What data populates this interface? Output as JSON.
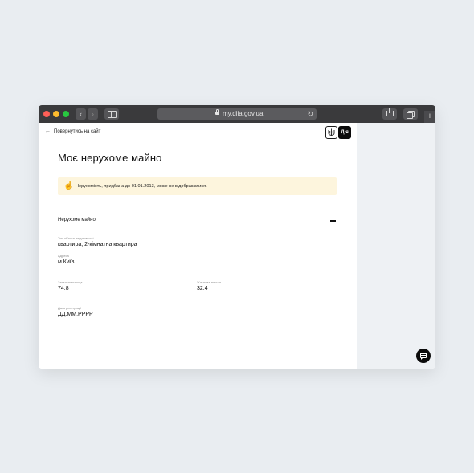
{
  "browser": {
    "url": "my.diia.gov.ua",
    "reload_icon": "↻",
    "nav_back_icon": "‹",
    "nav_forward_icon": "›",
    "new_tab_icon": "+"
  },
  "header": {
    "back_arrow": "←",
    "back_label": "Повернутись на сайт",
    "crest_icon": "trident",
    "logo_text": "Дія"
  },
  "page": {
    "title": "Моє нерухоме майно",
    "notice": {
      "icon": "☝",
      "text": "Нерухомість, придбана до 01.01.2013, може не відображатися."
    }
  },
  "section": {
    "title": "Нерухоме майно",
    "fields": {
      "object_type": {
        "label": "Тип об'єкта нерухомості",
        "value": "квартира, 2-кімнатна квартира"
      },
      "address": {
        "label": "Адреса",
        "value": "м.Київ"
      },
      "total_area": {
        "label": "Загальна площа",
        "value": "74.8"
      },
      "living_area": {
        "label": "Житлова площа",
        "value": "32.4"
      },
      "reg_date": {
        "label": "Дата реєстрації",
        "value": "ДД.ММ.РРРР"
      }
    }
  },
  "colors": {
    "toolbar": "#3a3a3c",
    "notice_bg": "#fdf5dd",
    "accent_black": "#0b0b0b"
  }
}
